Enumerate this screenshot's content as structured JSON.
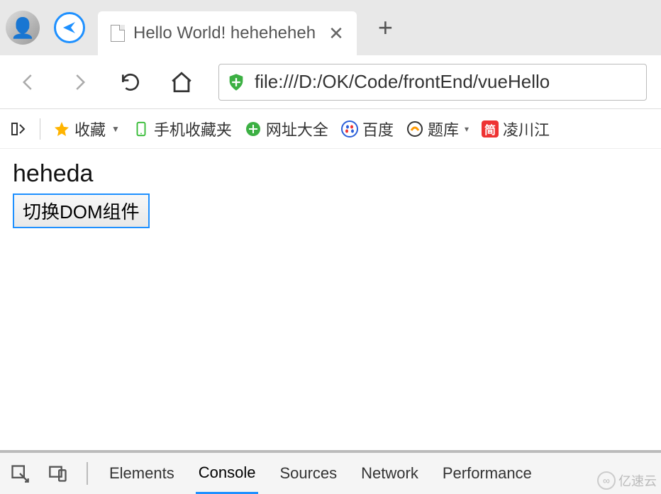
{
  "tab": {
    "title": "Hello World! heheheheh"
  },
  "url": "file:///D:/OK/Code/frontEnd/vueHello",
  "bookmarks": {
    "favorites": "收藏",
    "mobile": "手机收藏夹",
    "sites": "网址大全",
    "baidu": "百度",
    "tiku": "题库",
    "lingchuan": "凌川江"
  },
  "page": {
    "heading": "heheda",
    "button": "切换DOM组件"
  },
  "devtools": {
    "tabs": [
      "Elements",
      "Console",
      "Sources",
      "Network",
      "Performance"
    ],
    "active": 1
  },
  "watermark": "亿速云"
}
